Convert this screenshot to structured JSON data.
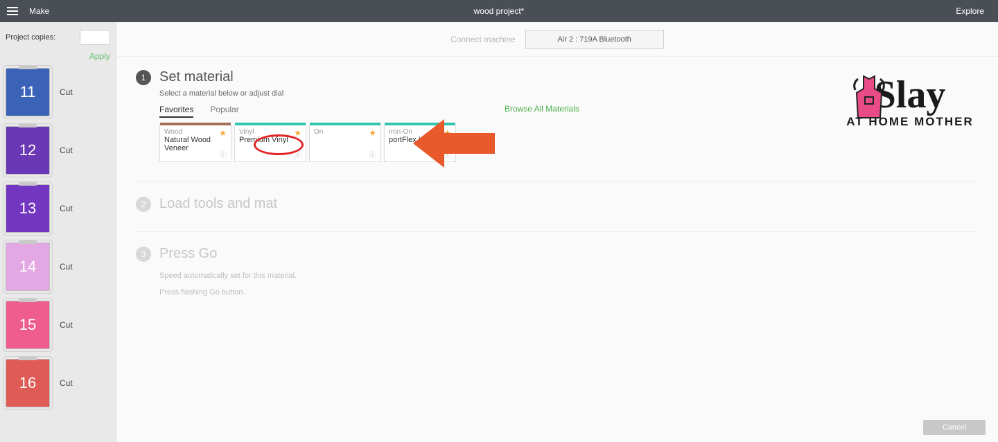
{
  "topbar": {
    "make": "Make",
    "title": "wood project*",
    "explore": "Explore"
  },
  "sidebar": {
    "copies_label": "Project copies:",
    "apply_label": "Apply",
    "mats": [
      {
        "num": "11",
        "cls": "blue",
        "label": "Cut"
      },
      {
        "num": "12",
        "cls": "purple1",
        "label": "Cut"
      },
      {
        "num": "13",
        "cls": "purple2",
        "label": "Cut"
      },
      {
        "num": "14",
        "cls": "pink1",
        "label": "Cut"
      },
      {
        "num": "15",
        "cls": "pink2",
        "label": "Cut"
      },
      {
        "num": "16",
        "cls": "red",
        "label": "Cut"
      }
    ]
  },
  "machine": {
    "connect": "Connect machine",
    "selected": "Air 2 : 719A Bluetooth"
  },
  "step1": {
    "num": "1",
    "title": "Set material",
    "sub": "Select a material below or adjust dial",
    "tabs": {
      "favorites": "Favorites",
      "popular": "Popular"
    },
    "browse": "Browse All Materials",
    "cards": [
      {
        "cat": "Wood",
        "name": "Natural Wood Veneer",
        "strip": "strip-brown"
      },
      {
        "cat": "Vinyl",
        "name": "Premium Vinyl",
        "strip": "strip-teal"
      },
      {
        "cat": "On",
        "name": "",
        "strip": "strip-teal"
      },
      {
        "cat": "Iron-On",
        "name": "portFlex Iron-On",
        "strip": "strip-teal"
      }
    ]
  },
  "step2": {
    "num": "2",
    "title": "Load tools and mat"
  },
  "step3": {
    "num": "3",
    "title": "Press Go",
    "line1": "Speed automatically set for this material.",
    "line2": "Press flashing Go button."
  },
  "footer": {
    "cancel": "Cancel"
  },
  "logo": {
    "slay": "Slay",
    "ahm": "AT HOME MOTHER"
  }
}
